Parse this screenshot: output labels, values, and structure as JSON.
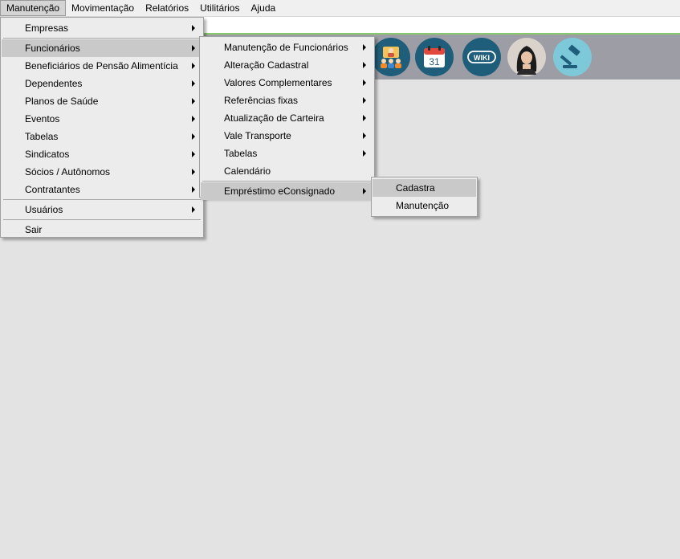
{
  "menubar": {
    "items": [
      {
        "label": "Manutenção",
        "active": true
      },
      {
        "label": "Movimentação"
      },
      {
        "label": "Relatórios"
      },
      {
        "label": "Utilitários"
      },
      {
        "label": "Ajuda"
      }
    ]
  },
  "toolbar": {
    "icons": [
      {
        "name": "employees-group-icon",
        "color": "#1f5e7a"
      },
      {
        "name": "calendar-icon",
        "text": "31",
        "color": "#1f5e7a"
      },
      {
        "name": "wiki-icon",
        "text": "WIKI",
        "color": "#1f5e7a"
      },
      {
        "name": "assistant-avatar-icon",
        "color": "#d9d3cc"
      },
      {
        "name": "gavel-icon",
        "color": "#7ec9d9"
      }
    ]
  },
  "menu_main": {
    "items": [
      {
        "label": "Empresas",
        "submenu": true
      },
      {
        "label": "Funcionários",
        "submenu": true,
        "highlight": true
      },
      {
        "label": "Beneficiários de Pensão Alimentícia",
        "submenu": true
      },
      {
        "label": "Dependentes",
        "submenu": true
      },
      {
        "label": "Planos de Saúde",
        "submenu": true
      },
      {
        "label": "Eventos",
        "submenu": true
      },
      {
        "label": "Tabelas",
        "submenu": true
      },
      {
        "label": "Sindicatos",
        "submenu": true
      },
      {
        "label": "Sócios / Autônomos",
        "submenu": true
      },
      {
        "label": "Contratantes",
        "submenu": true
      },
      {
        "label": "Usuários",
        "submenu": true
      },
      {
        "label": "Sair",
        "submenu": false
      }
    ]
  },
  "menu_funcionarios": {
    "items": [
      {
        "label": "Manutenção de Funcionários",
        "submenu": true
      },
      {
        "label": "Alteração Cadastral",
        "submenu": true
      },
      {
        "label": "Valores Complementares",
        "submenu": true
      },
      {
        "label": "Referências fixas",
        "submenu": true
      },
      {
        "label": "Atualização de Carteira",
        "submenu": true
      },
      {
        "label": "Vale Transporte",
        "submenu": true
      },
      {
        "label": "Tabelas",
        "submenu": true
      },
      {
        "label": "Calendário",
        "submenu": false
      },
      {
        "label": "Empréstimo eConsignado",
        "submenu": true,
        "highlight": true
      }
    ]
  },
  "menu_consignado": {
    "items": [
      {
        "label": "Cadastra",
        "highlight": true
      },
      {
        "label": "Manutenção"
      }
    ]
  }
}
